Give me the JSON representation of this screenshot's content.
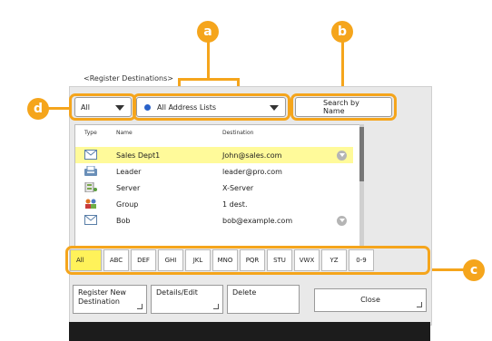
{
  "screen_title": "<Register Destinations>",
  "type_filter": {
    "value": "All"
  },
  "address_list": {
    "value": "All Address Lists"
  },
  "search_button": {
    "label": "Search by Name"
  },
  "list": {
    "headers": {
      "type": "Type",
      "name": "Name",
      "destination": "Destination"
    },
    "rows": [
      {
        "type_icon": "email-icon",
        "name": "Sales Dept1",
        "destination": "John@sales.com",
        "selected": true,
        "has_more": true
      },
      {
        "type_icon": "fax-icon",
        "name": "Leader",
        "destination": "leader@pro.com",
        "selected": false,
        "has_more": false
      },
      {
        "type_icon": "server-icon",
        "name": "Server",
        "destination": "X-Server",
        "selected": false,
        "has_more": false
      },
      {
        "type_icon": "group-icon",
        "name": "Group",
        "destination": "1 dest.",
        "selected": false,
        "has_more": false
      },
      {
        "type_icon": "email-icon",
        "name": "Bob",
        "destination": "bob@example.com",
        "selected": false,
        "has_more": true
      }
    ]
  },
  "index_keys": [
    "All",
    "ABC",
    "DEF",
    "GHI",
    "JKL",
    "MNO",
    "PQR",
    "STU",
    "VWX",
    "YZ",
    "0-9"
  ],
  "buttons": {
    "register_new": "Register New Destination",
    "details_edit": "Details/Edit",
    "delete": "Delete",
    "close": "Close"
  },
  "callouts": {
    "a": "a",
    "b": "b",
    "c": "c",
    "d": "d"
  },
  "colors": {
    "accent": "#f5a51c",
    "selected_row": "#fffa9a",
    "active_key": "#fff25a"
  }
}
